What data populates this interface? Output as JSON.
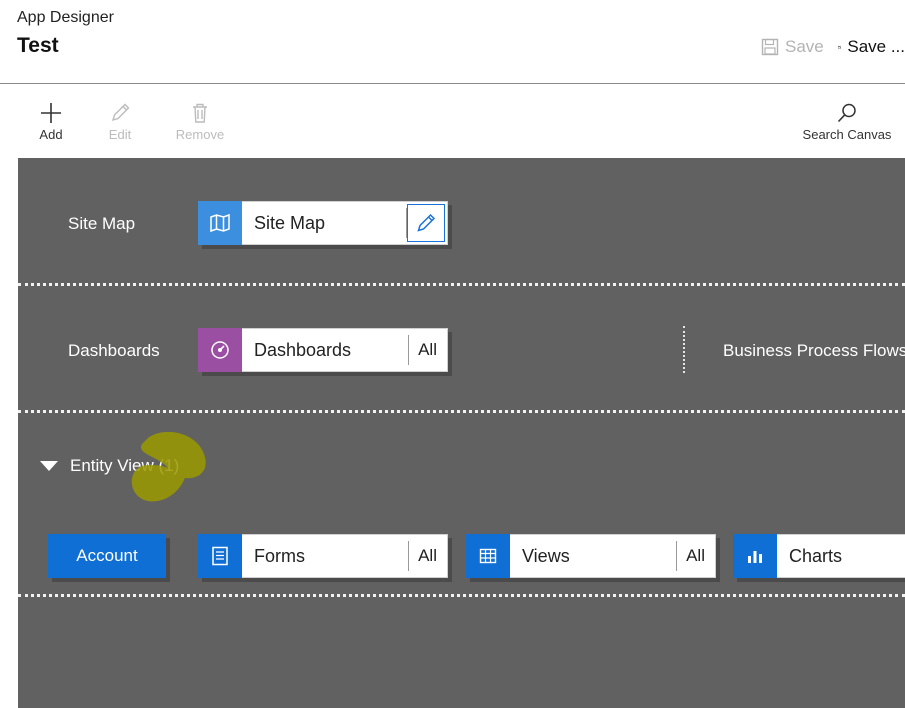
{
  "header": {
    "app_name": "App Designer",
    "title": "Test",
    "save_label": "Save",
    "save_as_label": "Save ..."
  },
  "toolbar": {
    "add_label": "Add",
    "edit_label": "Edit",
    "remove_label": "Remove",
    "search_label": "Search Canvas"
  },
  "canvas": {
    "site_map_row": {
      "label": "Site Map",
      "tile_label": "Site Map"
    },
    "dashboards_row": {
      "label": "Dashboards",
      "tile_label": "Dashboards",
      "tile_all": "All",
      "bpf_label": "Business Process Flows"
    },
    "entity_view": {
      "label": "Entity View (1)",
      "account_label": "Account",
      "forms_label": "Forms",
      "forms_all": "All",
      "views_label": "Views",
      "views_all": "All",
      "charts_label": "Charts"
    }
  },
  "colors": {
    "canvas_bg": "#616161",
    "site_map_icon_bg": "#3b8fde",
    "dashboards_icon_bg": "#9b4fa3",
    "entity_icon_bg": "#0f6fd5",
    "account_bg": "#0f6fd5",
    "highlight": "#9a9a00"
  }
}
